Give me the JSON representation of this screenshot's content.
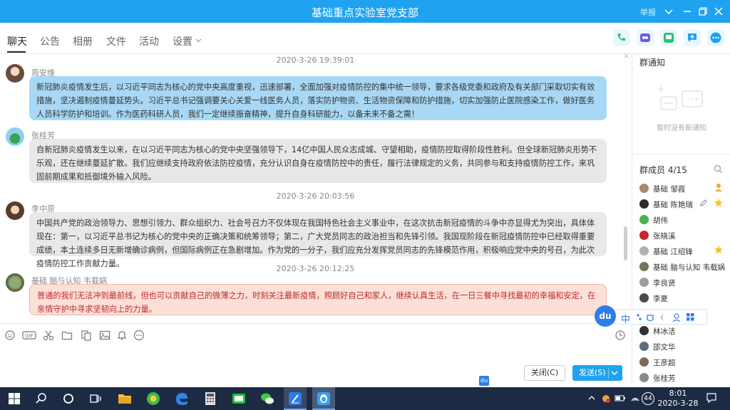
{
  "window": {
    "title": "基础重点实验室党支部",
    "report_label": "举报"
  },
  "tabs": [
    {
      "label": "聊天"
    },
    {
      "label": "公告"
    },
    {
      "label": "相册"
    },
    {
      "label": "文件"
    },
    {
      "label": "活动"
    },
    {
      "label": "设置"
    }
  ],
  "messages": [
    {
      "timestamp": "2020-3-26 19:39:01",
      "sender": "周安维",
      "text": "新冠肺炎疫情发生后，以习近平同志为核心的党中央高度重视，迅速部署，全面加强对疫情防控的集中统一领导，要求各级党委和政府及有关部门采取切实有效措施，坚决遏制疫情蔓延势头。习近平总书记强调要关心关爱一线医务人员，落实防护物资、生活物资保障和防护措施，切实加强防止医院感染工作，做好医务人员科学防护和培训。作为医药科研人员，我们一定继续振奋精神，提升自身科研能力，以备未来不备之需！"
    },
    {
      "timestamp": "",
      "sender": "张桂芳",
      "text": "自新冠肺炎疫情发生以来，在以习近平同志为核心的党中央坚强领导下，14亿中国人民众志成城、守望相助，疫情防控取得阶段性胜利。但全球新冠肺炎形势不乐观，还在继续蔓延扩散。我们应继续支持政府依法防控疫情，充分认识自身在疫情防控中的责任，履行法律规定的义务，共同参与和支持疫情防控工作，来巩固前期成果和抵御境外输入风险。"
    },
    {
      "timestamp": "2020-3-26 20:03:56",
      "sender": "李中原",
      "text": "中国共产党的政治领导力、思想引领力、群众组织力、社会号召力不仅体现在我国特色社会主义事业中，在这次抗击新冠疫情的斗争中亦显得尤为突出，具体体现在：第一，以习近平总书记为核心的党中央的正确决策和统筹领导；第二，广大党员同志的政治担当和先锋引领。我国现阶段在新冠疫情防控中已经取得重要成绩，本土连续多日无新增确诊病例，但国际病例正在急剧增加。作为党的一分子，我们应充分发挥党员同志的先锋模范作用，积极响应党中央的号召，为此次疫情防控工作贡献力量。"
    },
    {
      "timestamp": "2020-3-26 20:12:25",
      "sender": "基础 脑与认知 韦载娲",
      "text": "普通的我们无法冲到最前线，但也可以贡献自己的微薄之力，时刻关注最新疫情，照顾好自己和家人，继续认真生活，在一日三餐中寻找最初的幸福和安定，在亲情守护中寻求坚韧向上的力量。"
    }
  ],
  "composer": {
    "close_label": "关闭(C)",
    "send_label": "发送(S)"
  },
  "right_panel": {
    "notice_title": "群通知",
    "notice_empty": "暂时没有新通知",
    "members_title": "群成员 4/15",
    "members": [
      {
        "name": "基础 邹霞"
      },
      {
        "name": "基础 陈艳瑞"
      },
      {
        "name": "胡伟"
      },
      {
        "name": "张晓溪"
      },
      {
        "name": "基础 江绍锋"
      },
      {
        "name": "基础 脑与认知 韦载娲"
      },
      {
        "name": "李良贤"
      },
      {
        "name": "李夏"
      },
      {
        "name": ""
      },
      {
        "name": "林冰洁"
      },
      {
        "name": "邵文华"
      },
      {
        "name": "王彦超"
      },
      {
        "name": "张桂芳"
      }
    ]
  },
  "ime": {
    "logo": "du",
    "mode": "中"
  },
  "taskbar": {
    "time": "8:01",
    "date": "2020-3-28",
    "battery": "44"
  }
}
